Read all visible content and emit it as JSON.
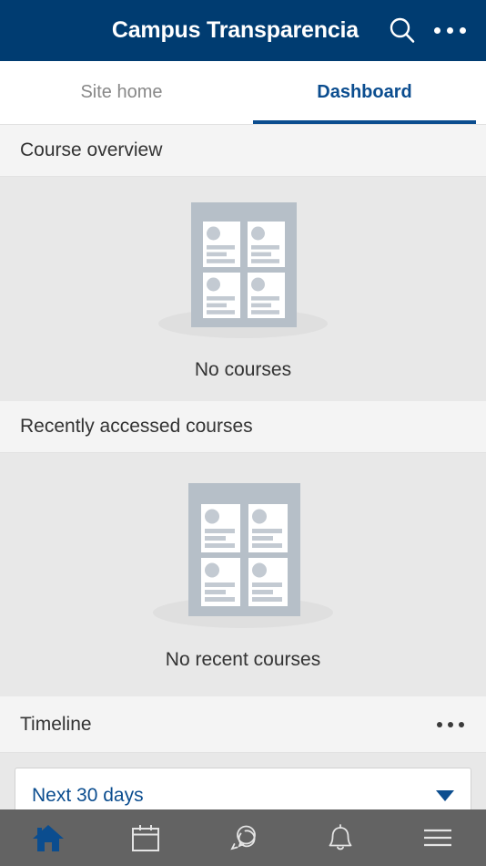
{
  "appbar": {
    "title": "Campus Transparencia",
    "search_icon": "search-icon",
    "more_icon": "more-horizontal-icon",
    "background_color": "#003c71"
  },
  "tabs": [
    {
      "label": "Site home",
      "active": false
    },
    {
      "label": "Dashboard",
      "active": true
    }
  ],
  "sections": {
    "course_overview": {
      "title": "Course overview",
      "empty_message": "No courses",
      "illustration": "courses-placeholder-icon"
    },
    "recently_accessed": {
      "title": "Recently accessed courses",
      "empty_message": "No recent courses",
      "illustration": "courses-placeholder-icon"
    },
    "timeline": {
      "title": "Timeline",
      "menu_icon": "more-horizontal-icon",
      "filter_value": "Next 30 days",
      "caret_icon": "chevron-down-icon"
    }
  },
  "bottom_nav": [
    {
      "icon": "home-icon",
      "active": true
    },
    {
      "icon": "calendar-icon",
      "active": false
    },
    {
      "icon": "messages-icon",
      "active": false
    },
    {
      "icon": "notifications-bell-icon",
      "active": false
    },
    {
      "icon": "hamburger-menu-icon",
      "active": false
    }
  ],
  "colors": {
    "brand_blue": "#003c71",
    "accent_blue": "#0b4d8f",
    "nav_background": "#636363",
    "content_background": "#e8e8e8",
    "section_header_background": "#f4f4f4",
    "illustration_frame": "#b6bfc8",
    "illustration_detail": "#c3cad2"
  }
}
